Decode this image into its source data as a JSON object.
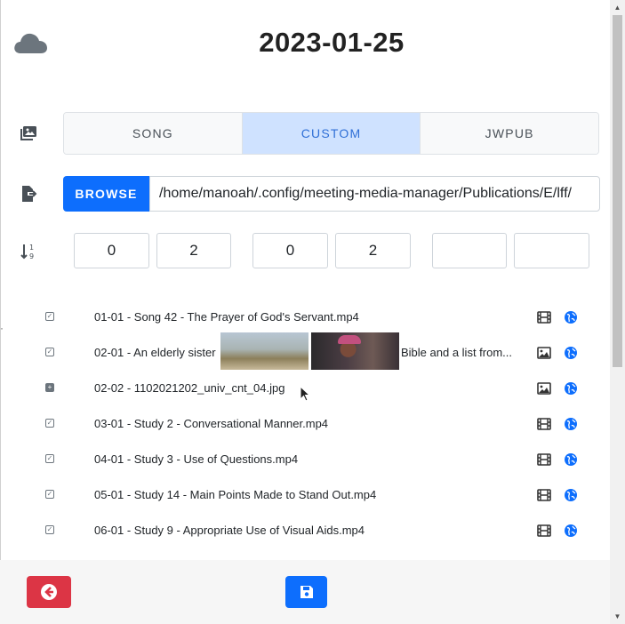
{
  "header": {
    "date": "2023-01-25",
    "cloud_icon": "cloud-icon"
  },
  "type_tabs": {
    "icon": "media-library-icon",
    "items": [
      {
        "label": "SONG",
        "active": false
      },
      {
        "label": "CUSTOM",
        "active": true
      },
      {
        "label": "JWPUB",
        "active": false
      }
    ]
  },
  "browse": {
    "icon": "file-export-icon",
    "button_label": "BROWSE",
    "path_value": "/home/manoah/.config/meeting-media-manager/Publications/E/lff/"
  },
  "sort": {
    "icon": "sort-numeric-icon",
    "fields": [
      "0",
      "2",
      "0",
      "2",
      "",
      ""
    ]
  },
  "media_items": [
    {
      "label": "01-01 - Song 42 - The Prayer of God's Servant.mp4",
      "type_icon": "film-icon",
      "checked": true
    },
    {
      "label_start": "02-01 - An elderly sister",
      "label_end": "Bible and a list from...",
      "type_icon": "image-icon",
      "checked": true
    },
    {
      "label": "02-02 - 1102021202_univ_cnt_04.jpg",
      "type_icon": "image-icon",
      "checked": false
    },
    {
      "label": "03-01 - Study 2 - Conversational Manner.mp4",
      "type_icon": "film-icon",
      "checked": true
    },
    {
      "label": "04-01 - Study 3 - Use of Questions.mp4",
      "type_icon": "film-icon",
      "checked": true
    },
    {
      "label": "05-01 - Study 14 - Main Points Made to Stand Out.mp4",
      "type_icon": "film-icon",
      "checked": true
    },
    {
      "label": "06-01 - Study 9 - Appropriate Use of Visual Aids.mp4",
      "type_icon": "film-icon",
      "checked": true
    }
  ],
  "colors": {
    "primary": "#0d6efd",
    "danger": "#dc3545",
    "tab_active_bg": "#cfe2ff"
  }
}
